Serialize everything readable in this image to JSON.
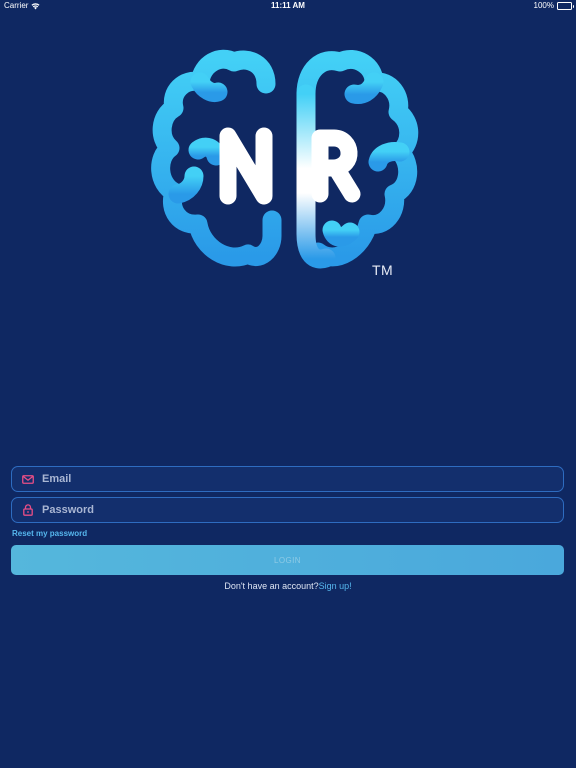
{
  "status_bar": {
    "carrier": "Carrier",
    "time": "11:11 AM",
    "battery": "100%",
    "battery_level": 1.0
  },
  "logo": {
    "letters_left": "N",
    "letters_right": "R",
    "trademark": "TM",
    "colors": {
      "brain_top": "#3ec6f4",
      "brain_bottom": "#2a9ce8",
      "letters": "#ffffff"
    }
  },
  "form": {
    "email": {
      "placeholder": "Email",
      "value": "",
      "icon": "envelope-icon",
      "icon_color": "#e94e86"
    },
    "password": {
      "placeholder": "Password",
      "value": "",
      "icon": "lock-icon",
      "icon_color": "#e94e86"
    },
    "reset_link": "Reset my password",
    "login_label": "LOGIN",
    "signup_prompt": "Don't have an account?",
    "signup_link": "Sign up!"
  },
  "colors": {
    "background": "#0f2862",
    "field_border": "#2e6cc0",
    "accent_link": "#56b7ee",
    "button": "#4fb0dc"
  }
}
